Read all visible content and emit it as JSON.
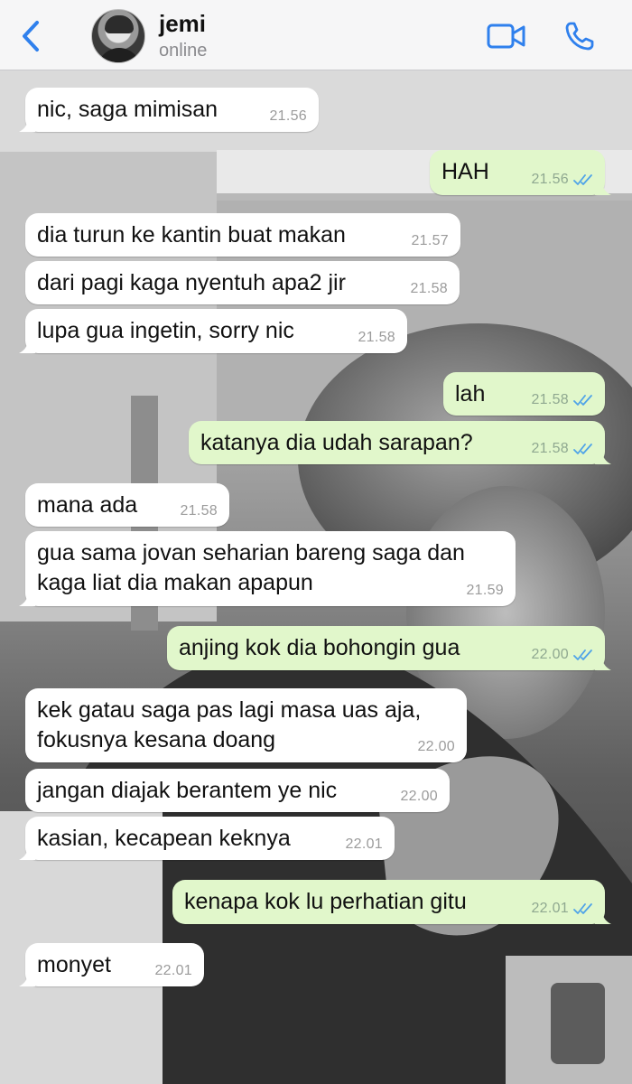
{
  "header": {
    "contact_name": "jemi",
    "status": "online",
    "icons": {
      "back": "chevron-left-icon",
      "video": "video-camera-icon",
      "call": "phone-icon"
    },
    "accent_color": "#2f80ed"
  },
  "colors": {
    "incoming_bubble": "#ffffff",
    "outgoing_bubble": "#e1f7cb",
    "read_ticks": "#4fa3e8"
  },
  "messages": [
    {
      "direction": "in",
      "text": "nic, saga mimisan",
      "time": "21.56"
    },
    {
      "direction": "out",
      "text": "HAH",
      "time": "21.56",
      "read": true
    },
    {
      "direction": "in",
      "text": "dia turun ke kantin buat makan",
      "time": "21.57"
    },
    {
      "direction": "in",
      "text": "dari pagi kaga nyentuh apa2 jir",
      "time": "21.58"
    },
    {
      "direction": "in",
      "text": "lupa gua ingetin, sorry nic",
      "time": "21.58"
    },
    {
      "direction": "out",
      "text": "lah",
      "time": "21.58",
      "read": true
    },
    {
      "direction": "out",
      "text": "katanya dia udah sarapan?",
      "time": "21.58",
      "read": true
    },
    {
      "direction": "in",
      "text": "mana ada",
      "time": "21.58"
    },
    {
      "direction": "in",
      "text": "gua sama jovan seharian bareng saga dan\nkaga liat dia makan apapun",
      "time": "21.59"
    },
    {
      "direction": "out",
      "text": "anjing kok dia bohongin gua",
      "time": "22.00",
      "read": true
    },
    {
      "direction": "in",
      "text": "kek gatau saga pas lagi masa uas aja,\nfokusnya kesana doang",
      "time": "22.00"
    },
    {
      "direction": "in",
      "text": "jangan diajak berantem ye nic",
      "time": "22.00"
    },
    {
      "direction": "in",
      "text": "kasian, kecapean keknya",
      "time": "22.01"
    },
    {
      "direction": "out",
      "text": "kenapa kok lu perhatian gitu",
      "time": "22.01",
      "read": true
    },
    {
      "direction": "in",
      "text": "monyet",
      "time": "22.01"
    }
  ]
}
